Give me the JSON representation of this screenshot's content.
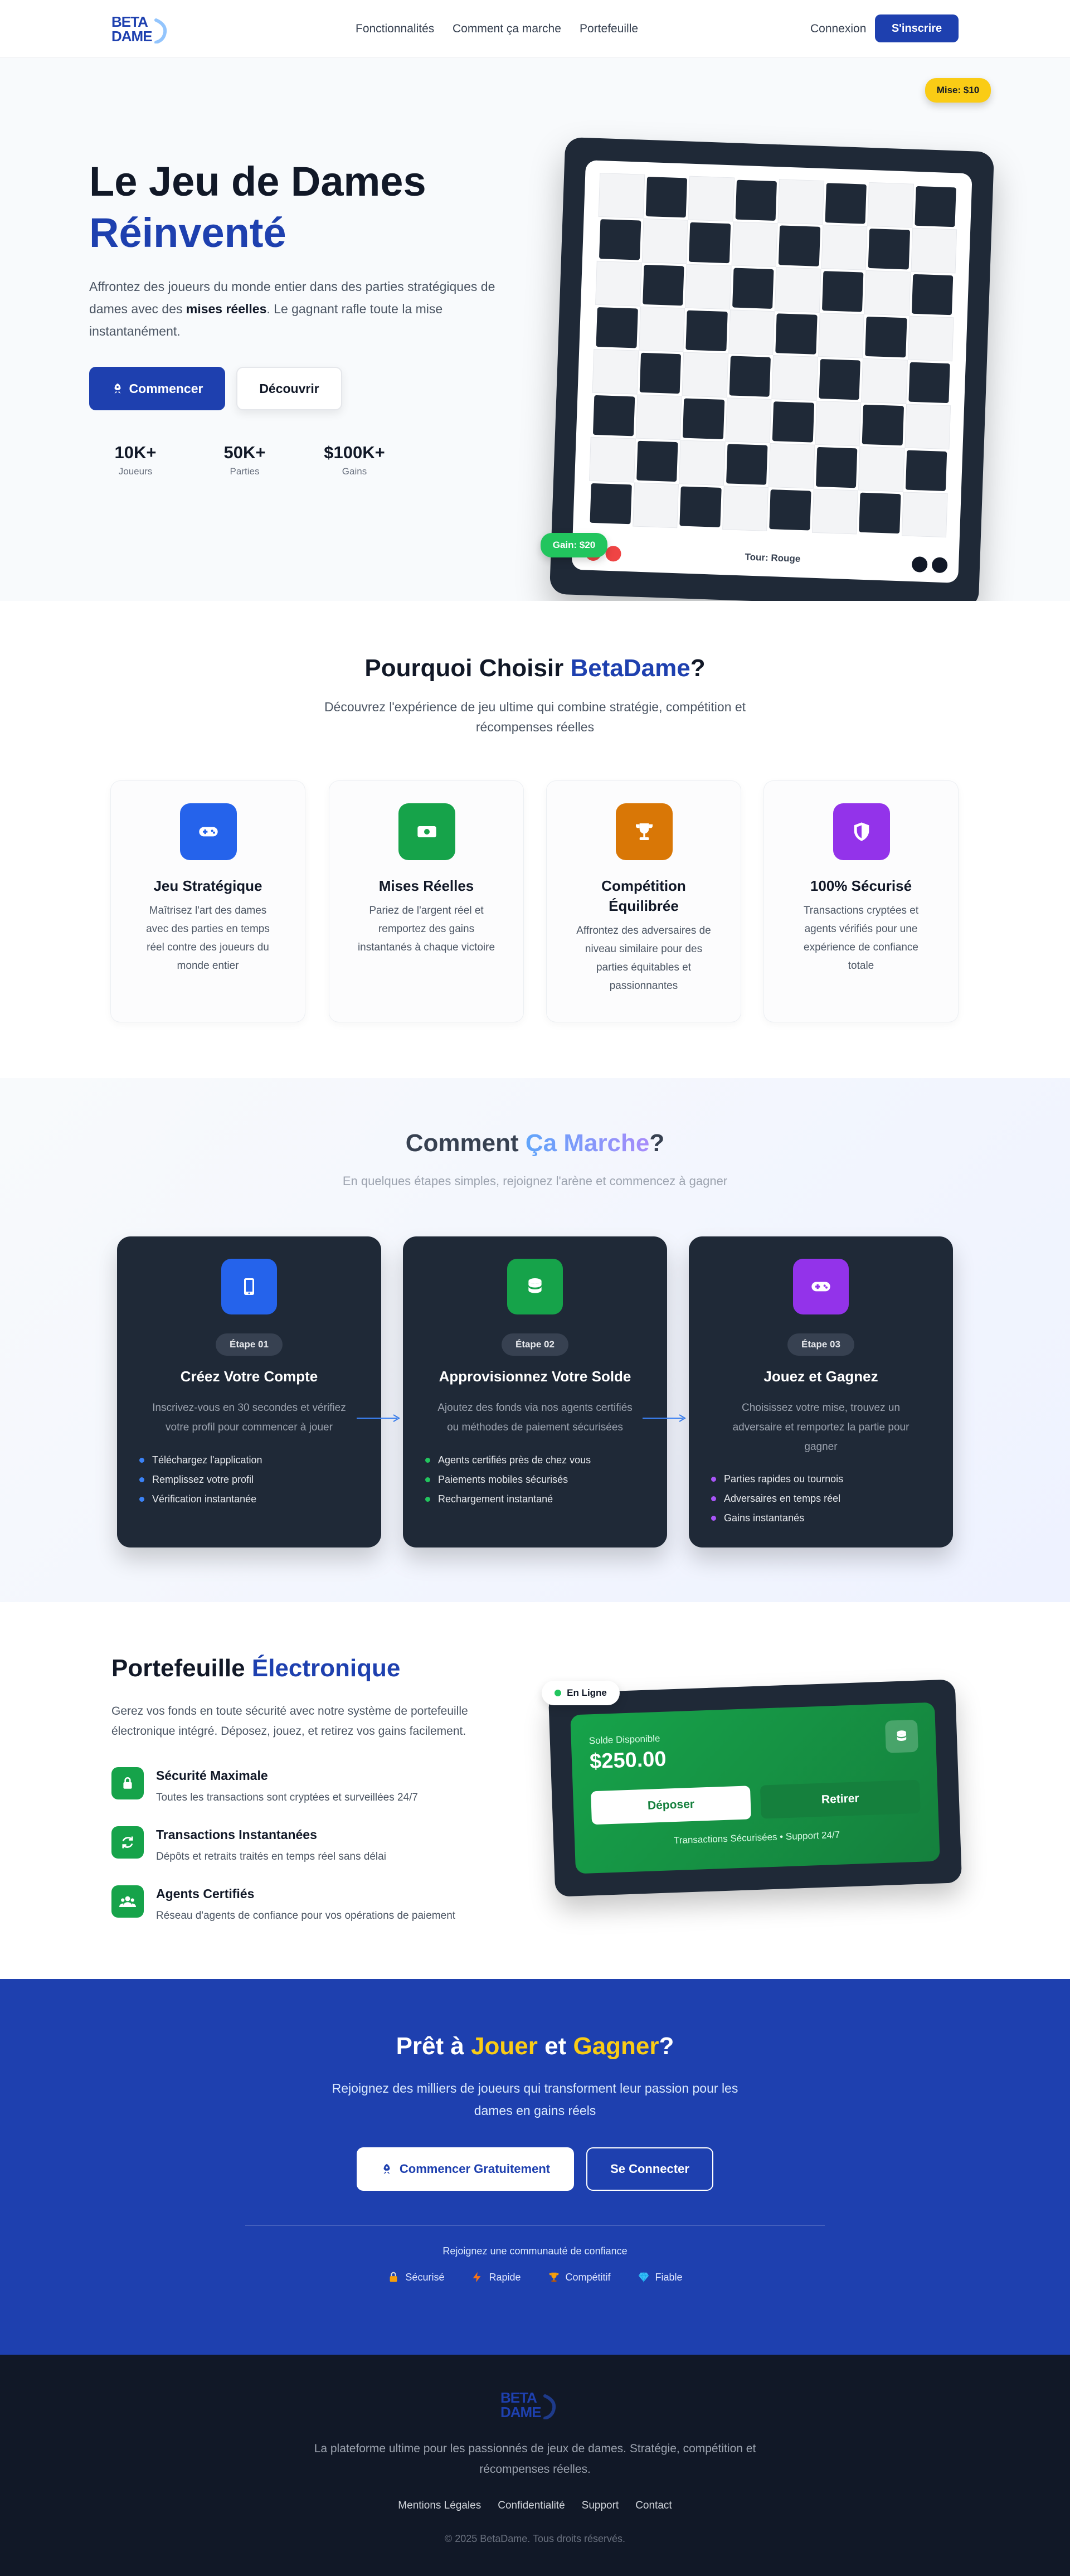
{
  "nav": {
    "logo_line1": "BETA",
    "logo_line2": "DAME",
    "links": [
      "Fonctionnalités",
      "Comment ça marche",
      "Portefeuille"
    ],
    "login": "Connexion",
    "signup": "S'inscrire"
  },
  "hero": {
    "title_line1": "Le Jeu de Dames",
    "title_line2": "Réinventé",
    "desc_part1": "Affrontez des joueurs du monde entier dans des parties stratégiques de dames avec des ",
    "desc_bold": "mises réelles",
    "desc_part2": ". Le gagnant rafle toute la mise instantanément.",
    "btn_primary": "Commencer",
    "btn_secondary": "Découvrir",
    "stats": [
      {
        "value": "10K+",
        "label": "Joueurs"
      },
      {
        "value": "50K+",
        "label": "Parties"
      },
      {
        "value": "$100K+",
        "label": "Gains"
      }
    ],
    "board": {
      "bet_badge": "Mise: $10",
      "gain_badge": "Gain: $20",
      "turn_label": "Tour: Rouge"
    }
  },
  "features": {
    "title_part1": "Pourquoi Choisir ",
    "title_brand": "BetaDame",
    "title_part2": "?",
    "subtitle": "Découvrez l'expérience de jeu ultime qui combine stratégie, compétition et récompenses réelles",
    "cards": [
      {
        "title": "Jeu Stratégique",
        "desc": "Maîtrisez l'art des dames avec des parties en temps réel contre des joueurs du monde entier",
        "icon": "gamepad-icon",
        "color": "#2563eb"
      },
      {
        "title": "Mises Réelles",
        "desc": "Pariez de l'argent réel et remportez des gains instantanés à chaque victoire",
        "icon": "money-icon",
        "color": "#16a34a"
      },
      {
        "title": "Compétition Équilibrée",
        "desc": "Affrontez des adversaires de niveau similaire pour des parties équitables et passionnantes",
        "icon": "trophy-icon",
        "color": "#d97706"
      },
      {
        "title": "100% Sécurisé",
        "desc": "Transactions cryptées et agents vérifiés pour une expérience de confiance totale",
        "icon": "shield-icon",
        "color": "#9333ea"
      }
    ]
  },
  "how": {
    "title_part1": "Comment ",
    "title_gradient": "Ça Marche",
    "title_part2": "?",
    "subtitle": "En quelques étapes simples, rejoignez l'arène et commencez à gagner",
    "steps": [
      {
        "step": "Étape 01",
        "title": "Créez Votre Compte",
        "desc": "Inscrivez-vous en 30 secondes et vérifiez votre profil pour commencer à jouer",
        "items": [
          "Téléchargez l'application",
          "Remplissez votre profil",
          "Vérification instantanée"
        ],
        "icon": "phone-icon",
        "color": "#2563eb"
      },
      {
        "step": "Étape 02",
        "title": "Approvisionnez Votre Solde",
        "desc": "Ajoutez des fonds via nos agents certifiés ou méthodes de paiement sécurisées",
        "items": [
          "Agents certifiés près de chez vous",
          "Paiements mobiles sécurisés",
          "Rechargement instantané"
        ],
        "icon": "coins-icon",
        "color": "#16a34a"
      },
      {
        "step": "Étape 03",
        "title": "Jouez et Gagnez",
        "desc": "Choisissez votre mise, trouvez un adversaire et remportez la partie pour gagner",
        "items": [
          "Parties rapides ou tournois",
          "Adversaires en temps réel",
          "Gains instantanés"
        ],
        "icon": "gamepad-icon",
        "color": "#9333ea"
      }
    ]
  },
  "wallet": {
    "title_part1": "Portefeuille ",
    "title_accent": "Électronique",
    "desc": "Gerez vos fonds en toute sécurité avec notre système de portefeuille électronique intégré. Déposez, jouez, et retirez vos gains facilement.",
    "features": [
      {
        "title": "Sécurité Maximale",
        "desc": "Toutes les transactions sont cryptées et surveillées 24/7",
        "icon": "lock-icon"
      },
      {
        "title": "Transactions Instantanées",
        "desc": "Dépôts et retraits traités en temps réel sans délai",
        "icon": "refresh-icon"
      },
      {
        "title": "Agents Certifiés",
        "desc": "Réseau d'agents de confiance pour vos opérations de paiement",
        "icon": "users-icon"
      }
    ],
    "card": {
      "online_badge": "En Ligne",
      "balance_label": "Solde Disponible",
      "balance": "$250.00",
      "deposit": "Déposer",
      "withdraw": "Retirer",
      "footer": "Transactions Sécurisées • Support 24/7"
    }
  },
  "cta": {
    "title_part1": "Prêt à ",
    "title_word1": "Jouer",
    "title_part2": " et ",
    "title_word2": "Gagner",
    "title_part3": "?",
    "subtitle": "Rejoignez des milliers de joueurs qui transforment leur passion pour les dames en gains réels",
    "btn_primary": "Commencer Gratuitement",
    "btn_secondary": "Se Connecter",
    "trust_label": "Rejoignez une communauté de confiance",
    "badges": [
      {
        "label": "Sécurisé",
        "icon": "lock-icon"
      },
      {
        "label": "Rapide",
        "icon": "lightning-icon"
      },
      {
        "label": "Compétitif",
        "icon": "trophy-icon"
      },
      {
        "label": "Fiable",
        "icon": "diamond-icon"
      }
    ]
  },
  "footer": {
    "logo_line1": "BETA",
    "logo_line2": "DAME",
    "desc": "La plateforme ultime pour les passionnés de jeux de dames. Stratégie, compétition et récompenses réelles.",
    "links": [
      "Mentions Légales",
      "Confidentialité",
      "Support",
      "Contact"
    ],
    "copyright": "© 2025 BetaDame. Tous droits réservés."
  }
}
